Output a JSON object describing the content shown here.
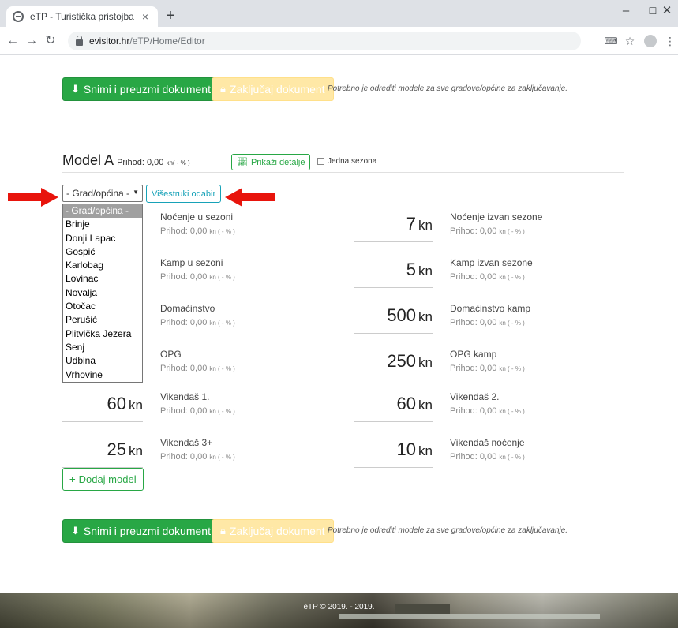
{
  "browser": {
    "tab_title": "eTP - Turistička pristojba",
    "tab_close": "×",
    "new_tab": "+",
    "url_host": "evisitor.hr",
    "url_path": "/eTP/Home/Editor",
    "window_controls": [
      "–",
      "☐",
      "✕"
    ]
  },
  "actions": {
    "save_label": "Snimi i preuzmi dokument",
    "lock_label": "Zaključaj dokument",
    "hint": "Potrebno je odrediti modele za sve gradove/općine za zaključavanje."
  },
  "model": {
    "title": "Model A",
    "income_prefix": "Prihod: 0,00 ",
    "income_unit": "kn",
    "income_suffix": "( - % )",
    "details_label": "Prikaži detalje",
    "single_season_label": "Jedna sezona",
    "multi_select_label": "Višestruki odabir",
    "add_model_label": "Dodaj model"
  },
  "city_select": {
    "selected": "- Grad/općina -",
    "options": [
      "- Grad/općina -",
      "Brinje",
      "Donji Lapac",
      "Gospić",
      "Karlobag",
      "Lovinac",
      "Novalja",
      "Otočac",
      "Perušić",
      "Plitvička Jezera",
      "Senj",
      "Udbina",
      "Vrhovine"
    ]
  },
  "unit": "kn",
  "fields": [
    {
      "label": "Noćenje u sezoni",
      "value": "",
      "income": "Prihod: 0,00 ",
      "income_small": "kn ( - % )"
    },
    {
      "label": "Noćenje izvan sezone",
      "value": "7",
      "income": "Prihod: 0,00 ",
      "income_small": "kn ( - % )"
    },
    {
      "label": "Kamp u sezoni",
      "value": "",
      "income": "Prihod: 0,00 ",
      "income_small": "kn ( - % )"
    },
    {
      "label": "Kamp izvan sezone",
      "value": "5",
      "income": "Prihod: 0,00 ",
      "income_small": "kn ( - % )"
    },
    {
      "label": "Domaćinstvo",
      "value": "",
      "income": "Prihod: 0,00 ",
      "income_small": "kn ( - % )"
    },
    {
      "label": "Domaćinstvo kamp",
      "value": "500",
      "income": "Prihod: 0,00 ",
      "income_small": "kn ( - % )"
    },
    {
      "label": "OPG",
      "value": "",
      "income": "Prihod: 0,00 ",
      "income_small": "kn ( - % )"
    },
    {
      "label": "OPG kamp",
      "value": "250",
      "income": "Prihod: 0,00 ",
      "income_small": "kn ( - % )"
    },
    {
      "label": "Vikendaš 1.",
      "value": "60",
      "income": "Prihod: 0,00 ",
      "income_small": "kn ( - % )"
    },
    {
      "label": "Vikendaš 2.",
      "value": "60",
      "income": "Prihod: 0,00 ",
      "income_small": "kn ( - % )"
    },
    {
      "label": "Vikendaš 3+",
      "value": "25",
      "income": "Prihod: 0,00 ",
      "income_small": "kn ( - % )"
    },
    {
      "label": "Vikendaš noćenje",
      "value": "10",
      "income": "Prihod: 0,00 ",
      "income_small": "kn ( - % )"
    }
  ],
  "footer": {
    "text": "eTP © 2019. - 2019."
  },
  "colors": {
    "accent_green": "#28a745",
    "lock_yellow": "#ffe8a6",
    "arrow_red": "#e8140c"
  }
}
